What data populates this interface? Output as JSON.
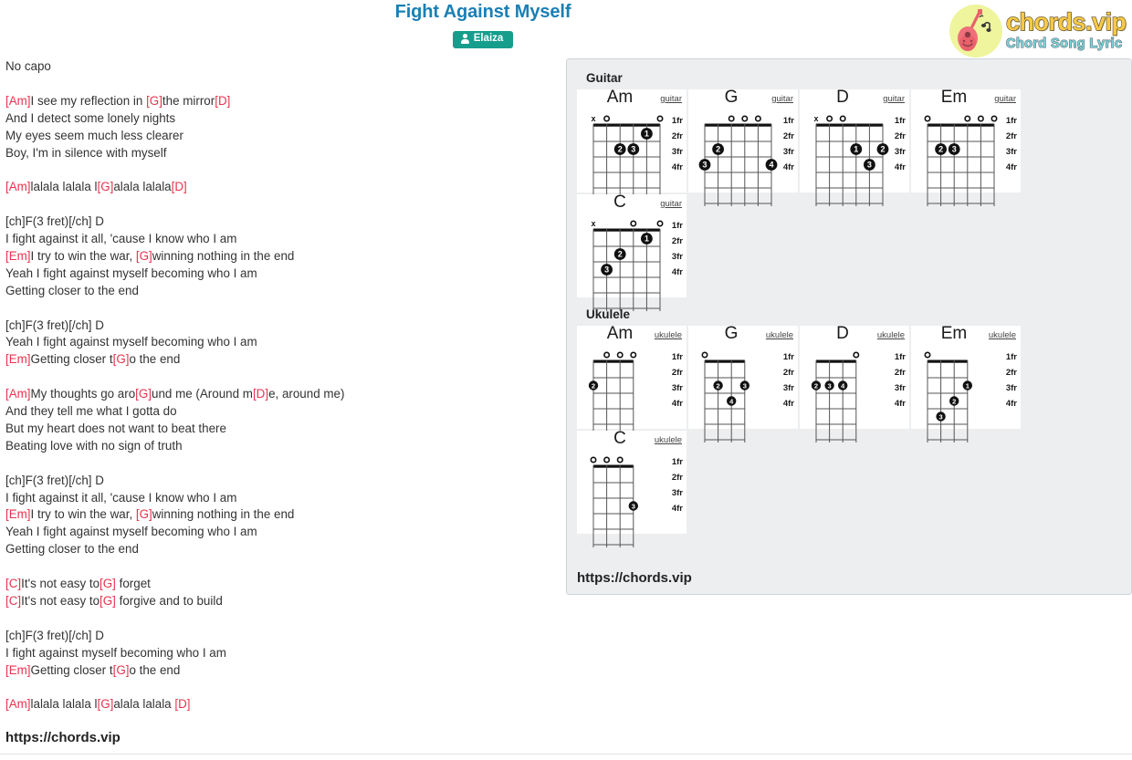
{
  "header": {
    "title": "Fight Against Myself",
    "artist": "Elaiza",
    "artist_icon": "person-icon"
  },
  "logo": {
    "main": "chords.vip",
    "sub": "Chord Song Lyric",
    "icon": "guitar-icon",
    "colors": {
      "main": "#f7c948",
      "sub": "#7fd4dd",
      "circle": "#eef59c"
    }
  },
  "lyrics": {
    "capo": "No capo",
    "blocks": [
      {
        "lines": [
          [
            {
              "t": "[Am]",
              "c": true
            },
            {
              "t": "I see my reflection in ",
              "c": false
            },
            {
              "t": "[G]",
              "c": true
            },
            {
              "t": "the mirror",
              "c": false
            },
            {
              "t": "[D]",
              "c": true
            }
          ],
          [
            {
              "t": "And I detect some lonely nights",
              "c": false
            }
          ],
          [
            {
              "t": "My eyes seem much less clearer",
              "c": false
            }
          ],
          [
            {
              "t": "Boy, I'm in silence with myself",
              "c": false
            }
          ]
        ]
      },
      {
        "lines": [
          [
            {
              "t": "[Am]",
              "c": true
            },
            {
              "t": "lalala lalala l",
              "c": false
            },
            {
              "t": "[G]",
              "c": true
            },
            {
              "t": "alala lalala",
              "c": false
            },
            {
              "t": "[D]",
              "c": true
            }
          ]
        ]
      },
      {
        "lines": [
          [
            {
              "t": "[ch]F(3 fret)[/ch] D",
              "c": false
            }
          ],
          [
            {
              "t": "I fight against it all, 'cause I know who I am",
              "c": false
            }
          ],
          [
            {
              "t": "[Em]",
              "c": true
            },
            {
              "t": "I try to win the war, ",
              "c": false
            },
            {
              "t": "[G]",
              "c": true
            },
            {
              "t": "winning nothing in the end",
              "c": false
            }
          ],
          [
            {
              "t": "Yeah I fight against myself becoming who I am",
              "c": false
            }
          ],
          [
            {
              "t": "Getting closer to the end",
              "c": false
            }
          ]
        ]
      },
      {
        "lines": [
          [
            {
              "t": "[ch]F(3 fret)[/ch] D",
              "c": false
            }
          ],
          [
            {
              "t": "Yeah I fight against myself becoming who I am",
              "c": false
            }
          ],
          [
            {
              "t": "[Em]",
              "c": true
            },
            {
              "t": "Getting closer t",
              "c": false
            },
            {
              "t": "[G]",
              "c": true
            },
            {
              "t": "o the end",
              "c": false
            }
          ]
        ]
      },
      {
        "lines": [
          [
            {
              "t": "[Am]",
              "c": true
            },
            {
              "t": "My thoughts go aro",
              "c": false
            },
            {
              "t": "[G]",
              "c": true
            },
            {
              "t": "und me (Around m",
              "c": false
            },
            {
              "t": "[D]",
              "c": true
            },
            {
              "t": "e, around me)",
              "c": false
            }
          ],
          [
            {
              "t": "And they tell me what I gotta do",
              "c": false
            }
          ],
          [
            {
              "t": "But my heart does not want to beat there",
              "c": false
            }
          ],
          [
            {
              "t": "Beating love with no sign of truth",
              "c": false
            }
          ]
        ]
      },
      {
        "lines": [
          [
            {
              "t": "[ch]F(3 fret)[/ch] D",
              "c": false
            }
          ],
          [
            {
              "t": "I fight against it all, 'cause I know who I am",
              "c": false
            }
          ],
          [
            {
              "t": "[Em]",
              "c": true
            },
            {
              "t": "I try to win the war, ",
              "c": false
            },
            {
              "t": "[G]",
              "c": true
            },
            {
              "t": "winning nothing in the end",
              "c": false
            }
          ],
          [
            {
              "t": "Yeah I fight against myself becoming who I am",
              "c": false
            }
          ],
          [
            {
              "t": "Getting closer to the end",
              "c": false
            }
          ]
        ]
      },
      {
        "lines": [
          [
            {
              "t": "[C]",
              "c": true
            },
            {
              "t": "It's not easy to",
              "c": false
            },
            {
              "t": "[G]",
              "c": true
            },
            {
              "t": " forget",
              "c": false
            }
          ],
          [
            {
              "t": "[C]",
              "c": true
            },
            {
              "t": "It's not easy to",
              "c": false
            },
            {
              "t": "[G]",
              "c": true
            },
            {
              "t": " forgive and to build",
              "c": false
            }
          ]
        ]
      },
      {
        "lines": [
          [
            {
              "t": "[ch]F(3 fret)[/ch] D",
              "c": false
            }
          ],
          [
            {
              "t": "I fight against myself becoming who I am",
              "c": false
            }
          ],
          [
            {
              "t": "[Em]",
              "c": true
            },
            {
              "t": "Getting closer t",
              "c": false
            },
            {
              "t": "[G]",
              "c": true
            },
            {
              "t": "o the end",
              "c": false
            }
          ]
        ]
      },
      {
        "lines": [
          [
            {
              "t": "[Am]",
              "c": true
            },
            {
              "t": "lalala lalala l",
              "c": false
            },
            {
              "t": "[G]",
              "c": true
            },
            {
              "t": "alala lalala ",
              "c": false
            },
            {
              "t": "[D]",
              "c": true
            }
          ]
        ]
      }
    ],
    "site_url": "https://chords.vip",
    "chord_color": "#e8344e"
  },
  "chord_panel": {
    "site_url": "https://chords.vip",
    "sections": [
      {
        "label": "Guitar",
        "instrument": "guitar",
        "strings": 6,
        "frets": [
          "1fr",
          "2fr",
          "3fr",
          "4fr"
        ],
        "chords": [
          {
            "name": "Am",
            "open": [
              {
                "string": 6,
                "mark": "x"
              },
              {
                "string": 5,
                "mark": "o"
              },
              {
                "string": 1,
                "mark": "o"
              }
            ],
            "dots": [
              {
                "string": 2,
                "fret": 1,
                "finger": "1"
              },
              {
                "string": 4,
                "fret": 2,
                "finger": "2"
              },
              {
                "string": 3,
                "fret": 2,
                "finger": "3"
              }
            ]
          },
          {
            "name": "G",
            "open": [
              {
                "string": 4,
                "mark": "o"
              },
              {
                "string": 3,
                "mark": "o"
              },
              {
                "string": 2,
                "mark": "o"
              }
            ],
            "dots": [
              {
                "string": 5,
                "fret": 2,
                "finger": "2"
              },
              {
                "string": 6,
                "fret": 3,
                "finger": "3"
              },
              {
                "string": 1,
                "fret": 3,
                "finger": "4"
              }
            ]
          },
          {
            "name": "D",
            "open": [
              {
                "string": 6,
                "mark": "x"
              },
              {
                "string": 5,
                "mark": "o"
              },
              {
                "string": 4,
                "mark": "o"
              }
            ],
            "dots": [
              {
                "string": 3,
                "fret": 2,
                "finger": "1"
              },
              {
                "string": 1,
                "fret": 2,
                "finger": "2"
              },
              {
                "string": 2,
                "fret": 3,
                "finger": "3"
              }
            ]
          },
          {
            "name": "Em",
            "open": [
              {
                "string": 6,
                "mark": "o"
              },
              {
                "string": 3,
                "mark": "o"
              },
              {
                "string": 2,
                "mark": "o"
              },
              {
                "string": 1,
                "mark": "o"
              }
            ],
            "dots": [
              {
                "string": 5,
                "fret": 2,
                "finger": "2"
              },
              {
                "string": 4,
                "fret": 2,
                "finger": "3"
              }
            ]
          },
          {
            "name": "C",
            "open": [
              {
                "string": 6,
                "mark": "x"
              },
              {
                "string": 3,
                "mark": "o"
              },
              {
                "string": 1,
                "mark": "o"
              }
            ],
            "dots": [
              {
                "string": 2,
                "fret": 1,
                "finger": "1"
              },
              {
                "string": 4,
                "fret": 2,
                "finger": "2"
              },
              {
                "string": 5,
                "fret": 3,
                "finger": "3"
              }
            ]
          }
        ]
      },
      {
        "label": "Ukulele",
        "instrument": "ukulele",
        "strings": 4,
        "frets": [
          "1fr",
          "2fr",
          "3fr",
          "4fr"
        ],
        "chords": [
          {
            "name": "Am",
            "open": [
              {
                "string": 3,
                "mark": "o"
              },
              {
                "string": 2,
                "mark": "o"
              },
              {
                "string": 1,
                "mark": "o"
              }
            ],
            "dots": [
              {
                "string": 4,
                "fret": 2,
                "finger": "2"
              }
            ]
          },
          {
            "name": "G",
            "open": [
              {
                "string": 4,
                "mark": "o"
              }
            ],
            "dots": [
              {
                "string": 3,
                "fret": 2,
                "finger": "2"
              },
              {
                "string": 1,
                "fret": 2,
                "finger": "3"
              },
              {
                "string": 2,
                "fret": 3,
                "finger": "4"
              }
            ]
          },
          {
            "name": "D",
            "open": [
              {
                "string": 1,
                "mark": "o"
              }
            ],
            "dots": [
              {
                "string": 4,
                "fret": 2,
                "finger": "2"
              },
              {
                "string": 3,
                "fret": 2,
                "finger": "3"
              },
              {
                "string": 2,
                "fret": 2,
                "finger": "4"
              }
            ]
          },
          {
            "name": "Em",
            "open": [
              {
                "string": 4,
                "mark": "o"
              }
            ],
            "dots": [
              {
                "string": 1,
                "fret": 2,
                "finger": "1"
              },
              {
                "string": 2,
                "fret": 3,
                "finger": "2"
              },
              {
                "string": 3,
                "fret": 4,
                "finger": "3"
              }
            ]
          },
          {
            "name": "C",
            "open": [
              {
                "string": 4,
                "mark": "o"
              },
              {
                "string": 3,
                "mark": "o"
              },
              {
                "string": 2,
                "mark": "o"
              }
            ],
            "dots": [
              {
                "string": 1,
                "fret": 3,
                "finger": "3"
              }
            ]
          }
        ]
      }
    ]
  }
}
